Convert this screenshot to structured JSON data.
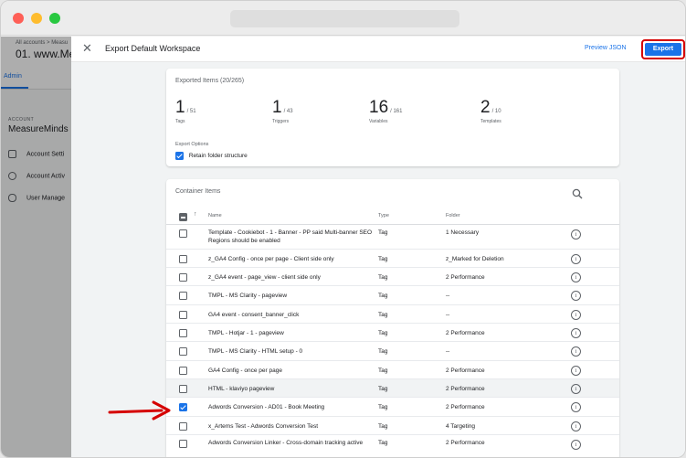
{
  "background": {
    "breadcrumb": "All accounts > Measu",
    "container_title": "01. www.Me",
    "tab": "Admin",
    "section": "ACCOUNT",
    "account_name": "MeasureMinds",
    "items": [
      "Account Setti",
      "Account Activ",
      "User Manage"
    ]
  },
  "panel": {
    "title": "Export Default Workspace",
    "preview_label": "Preview JSON",
    "export_label": "Export"
  },
  "summary": {
    "title": "Exported Items (20/265)",
    "stats": [
      {
        "count": "1",
        "total": "/ 51",
        "label": "Tags"
      },
      {
        "count": "1",
        "total": "/ 43",
        "label": "Triggers"
      },
      {
        "count": "16",
        "total": "/ 161",
        "label": "Variables"
      },
      {
        "count": "2",
        "total": "/ 10",
        "label": "Templates"
      }
    ],
    "options_label": "Export Options",
    "retain_label": "Retain folder structure"
  },
  "container": {
    "title": "Container Items",
    "headers": {
      "name": "Name",
      "type": "Type",
      "folder": "Folder"
    },
    "rows": [
      {
        "name": "Template - Cookiebot - 1 - Banner - PP said Multi-banner SEO Regions should be enabled",
        "type": "Tag",
        "folder": "1 Necessary",
        "checked": false
      },
      {
        "name": "z_GA4 Config - once per page - Client side only",
        "type": "Tag",
        "folder": "z_Marked for Deletion",
        "checked": false
      },
      {
        "name": "z_GA4 event - page_view - client side only",
        "type": "Tag",
        "folder": "2 Performance",
        "checked": false
      },
      {
        "name": "TMPL - MS Clarity - pageview",
        "type": "Tag",
        "folder": "--",
        "checked": false
      },
      {
        "name": "GA4 event - consent_banner_click",
        "type": "Tag",
        "folder": "--",
        "checked": false
      },
      {
        "name": "TMPL - Hotjar - 1 - pageview",
        "type": "Tag",
        "folder": "2 Performance",
        "checked": false
      },
      {
        "name": "TMPL - MS Clarity - HTML setup - 0",
        "type": "Tag",
        "folder": "--",
        "checked": false
      },
      {
        "name": "GA4 Config - once per page",
        "type": "Tag",
        "folder": "2 Performance",
        "checked": false
      },
      {
        "name": "HTML - klaviyo pageview",
        "type": "Tag",
        "folder": "2 Performance",
        "checked": false
      },
      {
        "name": "Adwords Conversion - AD01 - Book Meeting",
        "type": "Tag",
        "folder": "2 Performance",
        "checked": true
      },
      {
        "name": "x_Artems Test - Adwords Conversion Test",
        "type": "Tag",
        "folder": "4 Targeting",
        "checked": false
      },
      {
        "name": "Adwords Conversion Linker - Cross-domain tracking active",
        "type": "Tag",
        "folder": "2 Performance",
        "checked": false
      }
    ]
  },
  "colors": {
    "accent": "#1a73e8",
    "annotation": "#d50000"
  },
  "icons": {
    "close": "close-icon",
    "search": "search-icon",
    "info": "info-icon",
    "sort": "arrow-up-icon"
  }
}
